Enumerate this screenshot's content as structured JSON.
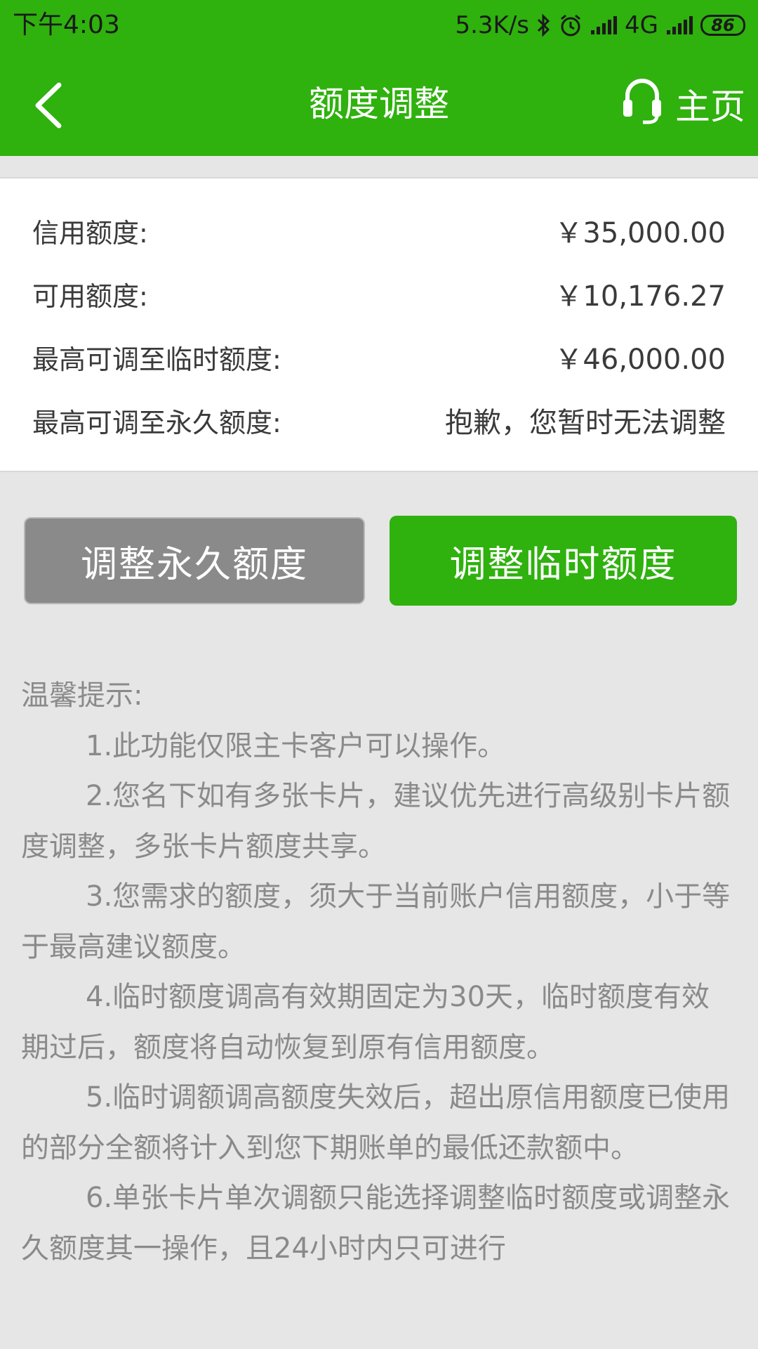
{
  "status_bar": {
    "time": "下午4:03",
    "speed": "5.3K/s",
    "network": "4G",
    "battery": "86",
    "icons": [
      "bluetooth-icon",
      "alarm-icon",
      "signal-icon",
      "signal-icon"
    ]
  },
  "header": {
    "title": "额度调整",
    "home_label": "主页",
    "back_icon": "chevron-left-icon",
    "home_icon": "headset-icon"
  },
  "limits": {
    "credit_label": "信用额度:",
    "credit_value": "￥35,000.00",
    "available_label": "可用额度:",
    "available_value": "￥10,176.27",
    "max_temp_label": "最高可调至临时额度:",
    "max_temp_value": "￥46,000.00",
    "max_perm_label": "最高可调至永久额度:",
    "max_perm_value": "抱歉，您暂时无法调整"
  },
  "buttons": {
    "permanent": "调整永久额度",
    "temporary": "调整临时额度"
  },
  "tips": {
    "title": "温馨提示:",
    "items": [
      "1.此功能仅限主卡客户可以操作。",
      "2.您名下如有多张卡片，建议优先进行高级别卡片额度调整，多张卡片额度共享。",
      "3.您需求的额度，须大于当前账户信用额度，小于等于最高建议额度。",
      "4.临时额度调高有效期固定为30天，临时额度有效期过后，额度将自动恢复到原有信用额度。",
      "5.临时调额调高额度失效后，超出原信用额度已使用的部分全额将计入到您下期账单的最低还款额中。",
      "6.单张卡片单次调额只能选择调整临时额度或调整永久额度其一操作，且24小时内只可进行"
    ]
  },
  "colors": {
    "brand_green": "#2fb10e",
    "disabled_gray": "#8a8a8a",
    "background": "#e6e6e6"
  }
}
